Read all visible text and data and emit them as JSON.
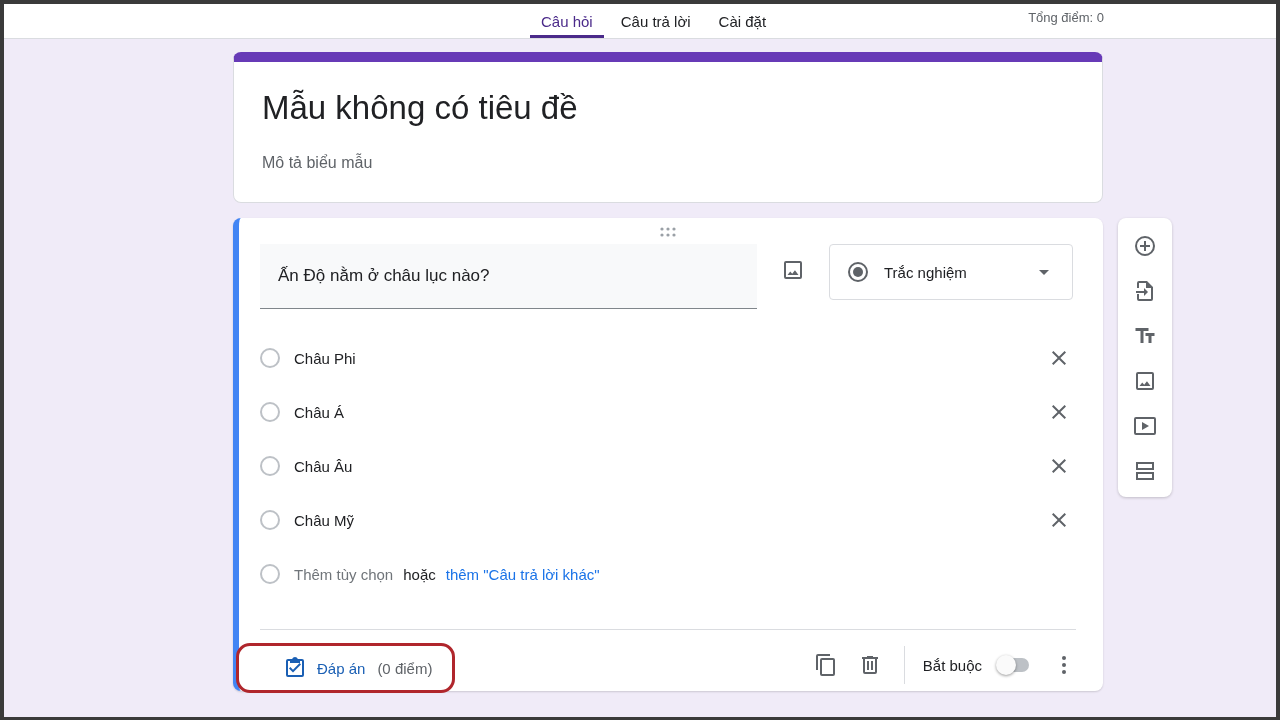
{
  "tabs": [
    {
      "label": "Câu hỏi",
      "selected": true
    },
    {
      "label": "Câu trả lời",
      "selected": false
    },
    {
      "label": "Cài đặt",
      "selected": false
    }
  ],
  "total_points": "Tổng điểm: 0",
  "form": {
    "title": "Mẫu không có tiêu đề",
    "description": "Mô tả biểu mẫu"
  },
  "question": {
    "text": "Ấn Độ nằm ở châu lục nào?",
    "type_label": "Trắc nghiệm",
    "options": [
      {
        "label": "Châu Phi",
        "selected": false
      },
      {
        "label": "Châu Á",
        "selected": false
      },
      {
        "label": "Châu Âu",
        "selected": false
      },
      {
        "label": "Châu Mỹ",
        "selected": false
      }
    ],
    "add_option": "Thêm tùy chọn",
    "or_text": "hoặc",
    "add_other": "thêm \"Câu trả lời khác\"",
    "answer_key": "Đáp án",
    "points": "(0 điểm)",
    "required_label": "Bắt buộc",
    "required": false
  }
}
